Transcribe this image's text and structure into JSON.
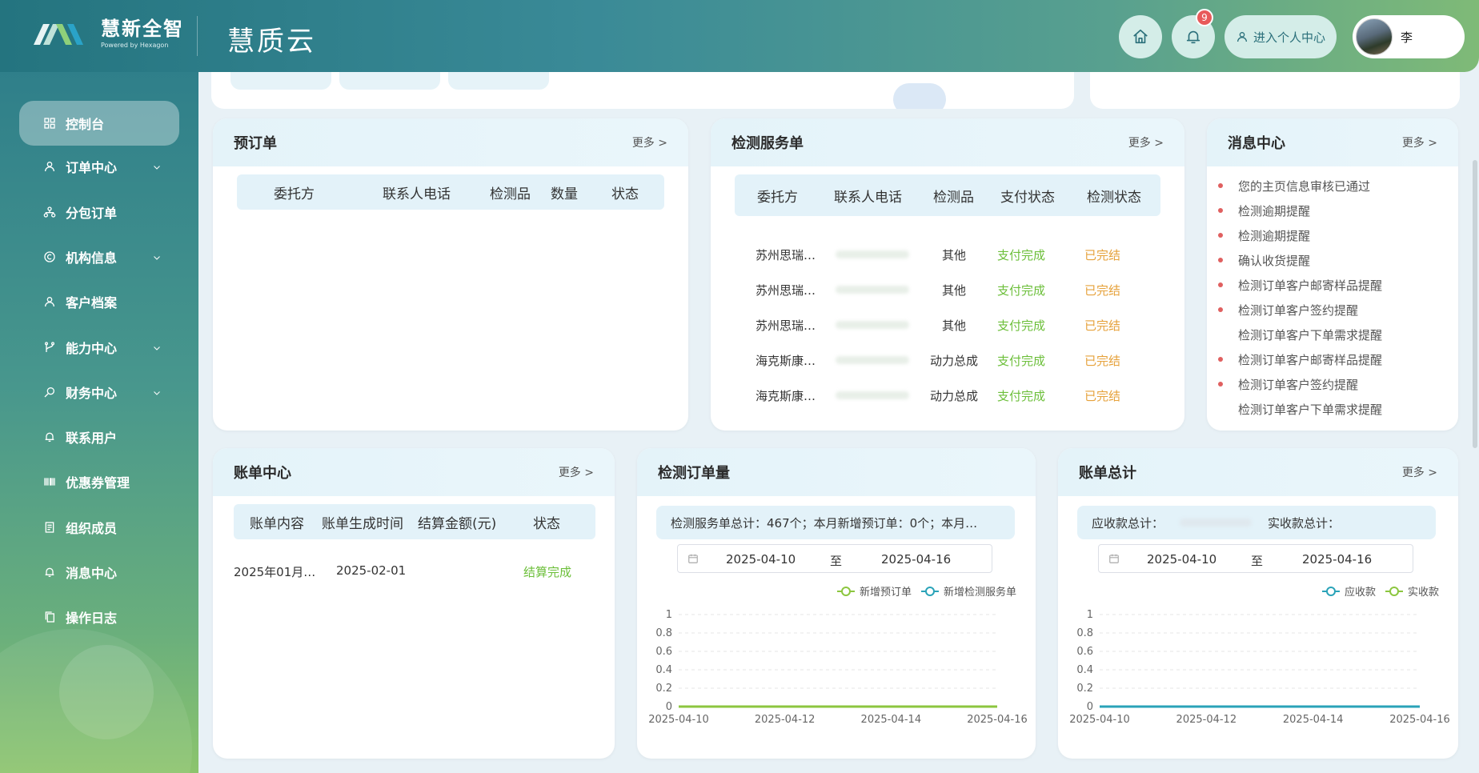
{
  "header": {
    "logo_name": "慧新全智",
    "logo_sub": "Powered by Hexagon",
    "app_title": "慧质云",
    "notification_count": "9",
    "center_label": "进入个人中心",
    "user_name": "李"
  },
  "sidebar": {
    "items": [
      {
        "label": "控制台",
        "icon": "dashboard-icon",
        "expandable": false
      },
      {
        "label": "订单中心",
        "icon": "user-icon",
        "expandable": true
      },
      {
        "label": "分包订单",
        "icon": "org-icon",
        "expandable": false
      },
      {
        "label": "机构信息",
        "icon": "copyright-icon",
        "expandable": true
      },
      {
        "label": "客户档案",
        "icon": "user-icon",
        "expandable": false
      },
      {
        "label": "能力中心",
        "icon": "branch-icon",
        "expandable": true
      },
      {
        "label": "财务中心",
        "icon": "search-icon",
        "expandable": true
      },
      {
        "label": "联系用户",
        "icon": "bell-icon",
        "expandable": false
      },
      {
        "label": "优惠券管理",
        "icon": "barcode-icon",
        "expandable": false
      },
      {
        "label": "组织成员",
        "icon": "doc-icon",
        "expandable": false
      },
      {
        "label": "消息中心",
        "icon": "bell-icon",
        "expandable": false
      },
      {
        "label": "操作日志",
        "icon": "copy-icon",
        "expandable": false
      }
    ]
  },
  "more_label": "更多 >",
  "preorder": {
    "title": "预订单",
    "columns": [
      "委托方",
      "联系人电话",
      "检测品",
      "数量",
      "状态"
    ]
  },
  "service": {
    "title": "检测服务单",
    "columns": [
      "委托方",
      "联系人电话",
      "检测品",
      "支付状态",
      "检测状态"
    ],
    "rows": [
      {
        "client": "苏州思瑞…",
        "item": "其他",
        "pay": "支付完成",
        "status": "已完结"
      },
      {
        "client": "苏州思瑞…",
        "item": "其他",
        "pay": "支付完成",
        "status": "已完结"
      },
      {
        "client": "苏州思瑞…",
        "item": "其他",
        "pay": "支付完成",
        "status": "已完结"
      },
      {
        "client": "海克斯康…",
        "item": "动力总成",
        "pay": "支付完成",
        "status": "已完结"
      },
      {
        "client": "海克斯康…",
        "item": "动力总成",
        "pay": "支付完成",
        "status": "已完结"
      }
    ]
  },
  "messages": {
    "title": "消息中心",
    "items": [
      {
        "text": "您的主页信息审核已通过",
        "unread": true
      },
      {
        "text": "检测逾期提醒",
        "unread": true
      },
      {
        "text": "检测逾期提醒",
        "unread": true
      },
      {
        "text": "确认收货提醒",
        "unread": true
      },
      {
        "text": "检测订单客户邮寄样品提醒",
        "unread": true
      },
      {
        "text": "检测订单客户签约提醒",
        "unread": true
      },
      {
        "text": "检测订单客户下单需求提醒",
        "unread": false
      },
      {
        "text": "检测订单客户邮寄样品提醒",
        "unread": true
      },
      {
        "text": "检测订单客户签约提醒",
        "unread": true
      },
      {
        "text": "检测订单客户下单需求提醒",
        "unread": false
      }
    ]
  },
  "bills": {
    "title": "账单中心",
    "columns": [
      "账单内容",
      "账单生成时间",
      "结算金额(元)",
      "状态"
    ],
    "rows": [
      {
        "content": "2025年01月…",
        "date": "2025-02-01",
        "status": "结算完成"
      }
    ]
  },
  "orders_chart": {
    "title": "检测订单量",
    "summary": "检测服务单总计：467个；本月新增预订单：0个；本月…",
    "date_from": "2025-04-10",
    "date_sep": "至",
    "date_to": "2025-04-16"
  },
  "bill_total": {
    "title": "账单总计",
    "receivable_label": "应收款总计：",
    "received_label": "实收款总计：",
    "date_from": "2025-04-10",
    "date_sep": "至",
    "date_to": "2025-04-16"
  },
  "colors": {
    "green": "#8cc63f",
    "teal": "#2aa3b8",
    "accent": "#2f7f8a"
  },
  "chart_data": [
    {
      "type": "line",
      "title": "检测订单量",
      "x": [
        "2025-04-10",
        "2025-04-11",
        "2025-04-12",
        "2025-04-13",
        "2025-04-14",
        "2025-04-15",
        "2025-04-16"
      ],
      "xticks": [
        "2025-04-10",
        "2025-04-12",
        "2025-04-14",
        "2025-04-16"
      ],
      "yticks": [
        "0",
        "0.2",
        "0.4",
        "0.6",
        "0.8",
        "1"
      ],
      "ylim": [
        0,
        1
      ],
      "series": [
        {
          "name": "新增预订单",
          "values": [
            0,
            0,
            0,
            0,
            0,
            0,
            0
          ],
          "color": "#8cc63f"
        },
        {
          "name": "新增检测服务单",
          "values": [
            0,
            0,
            0,
            0,
            0,
            0,
            0
          ],
          "color": "#2aa3b8"
        }
      ]
    },
    {
      "type": "line",
      "title": "账单总计",
      "x": [
        "2025-04-10",
        "2025-04-11",
        "2025-04-12",
        "2025-04-13",
        "2025-04-14",
        "2025-04-15",
        "2025-04-16"
      ],
      "xticks": [
        "2025-04-10",
        "2025-04-12",
        "2025-04-14",
        "2025-04-16"
      ],
      "yticks": [
        "0",
        "0.2",
        "0.4",
        "0.6",
        "0.8",
        "1"
      ],
      "ylim": [
        0,
        1
      ],
      "series": [
        {
          "name": "应收款",
          "values": [
            0,
            0,
            0,
            0,
            0,
            0,
            0
          ],
          "color": "#2aa3b8"
        },
        {
          "name": "实收款",
          "values": [
            0,
            0,
            0,
            0,
            0,
            0,
            0
          ],
          "color": "#8cc63f"
        }
      ]
    }
  ]
}
